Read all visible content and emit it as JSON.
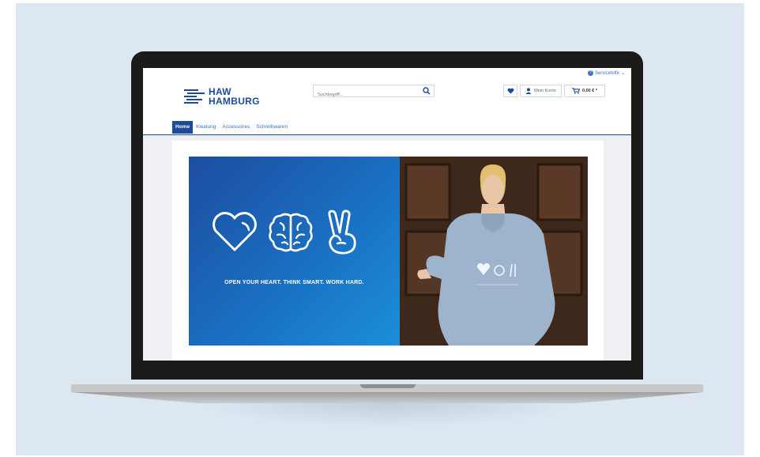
{
  "shop": {
    "service_help": "Servicehilfe",
    "logo_line1": "HAW",
    "logo_line2": "HAMBURG",
    "search_placeholder": "Suchbegriff...",
    "account_label": "Mein Konto",
    "cart_total": "0,00 € *",
    "nav": [
      {
        "label": "Home",
        "active": true
      },
      {
        "label": "Kleidung"
      },
      {
        "label": "Accessoires"
      },
      {
        "label": "Schreibwaren"
      }
    ],
    "banner_slogan": "OPEN YOUR HEART. THINK SMART. WORK HARD."
  },
  "colors": {
    "brand_blue": "#1e4a9c",
    "link_blue": "#3c73c4",
    "background": "#dce7f2"
  },
  "icons": [
    "heart-icon",
    "brain-icon",
    "victory-hand-icon",
    "search-icon",
    "user-icon",
    "cart-icon",
    "question-icon",
    "chevron-down-icon"
  ]
}
